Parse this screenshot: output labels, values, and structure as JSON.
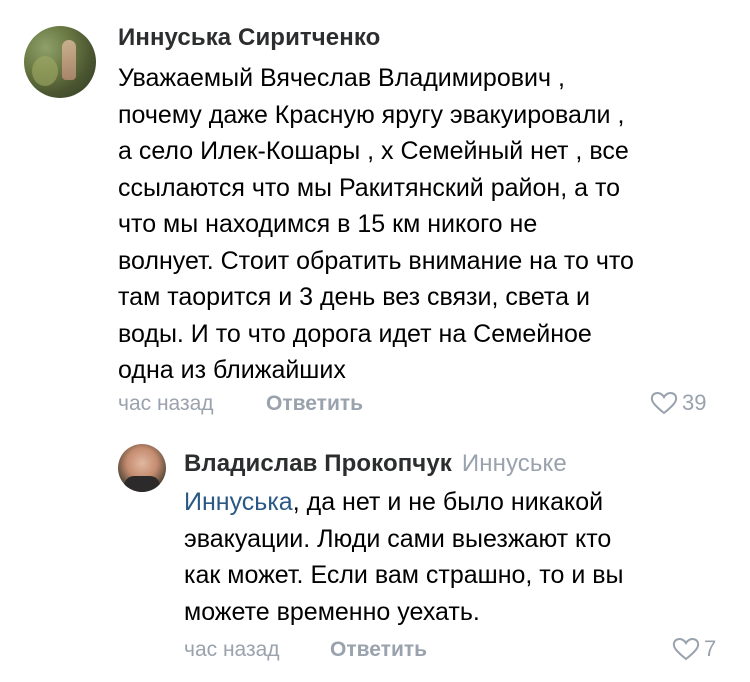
{
  "comments": [
    {
      "author": "Иннуська Сиритченко",
      "text": "Уважаемый Вячеслав Владимирович ,\nпочему даже Красную яругу эвакуировали ,\nа село Илек-Кошары , х Семейный нет , все\nссылаются что мы Ракитянский район, а то\nчто мы находимся в 15 км никого не\nволнует. Стоит обратить внимание на то что\nтам таорится и 3 день вез связи, света и\nводы. И то что дорога идет на Семейное\nодна из ближайших",
      "time": "час назад",
      "reply_label": "Ответить",
      "likes": "39",
      "avatar_icon": "user-avatar"
    }
  ],
  "reply": {
    "author": "Владислав Прокопчук",
    "reply_to": "Иннуське",
    "mention": "Иннуська",
    "text": ", да нет и не было никакой\nэвакуации. Люди сами выезжают кто\nкак может. Если вам страшно, то и вы\nможете временно уехать.",
    "time": "час назад",
    "reply_label": "Ответить",
    "likes": "7",
    "avatar_icon": "user-avatar"
  },
  "icons": {
    "like": "heart-icon"
  },
  "colors": {
    "secondary_text": "#99a2ad",
    "mention": "#2a5885",
    "author": "#2c2d2e"
  }
}
